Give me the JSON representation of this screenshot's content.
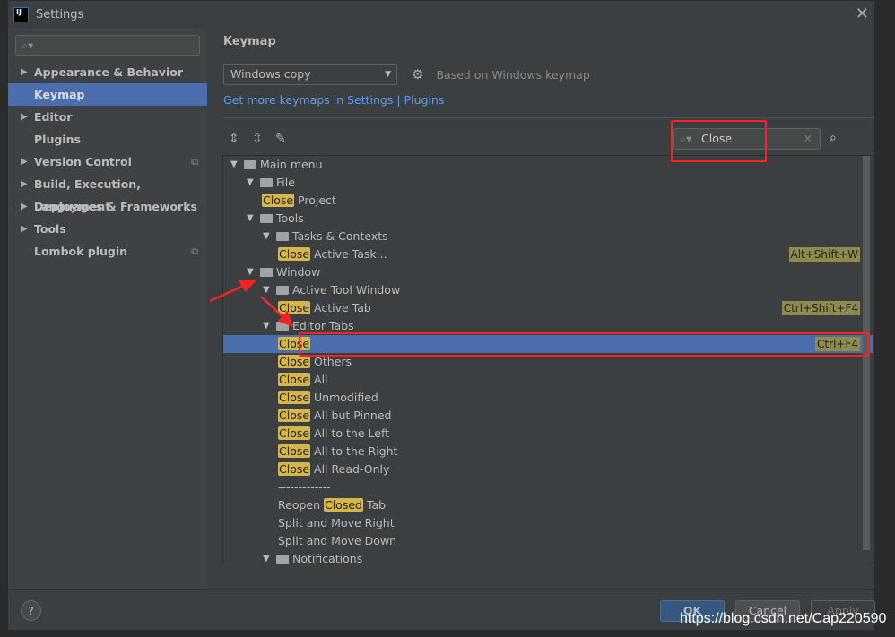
{
  "window": {
    "title": "Settings",
    "logo": "IJ"
  },
  "sidebar": {
    "search_placeholder": "",
    "items": [
      {
        "label": "Appearance & Behavior",
        "expandable": true
      },
      {
        "label": "Keymap",
        "selected": true
      },
      {
        "label": "Editor",
        "expandable": true
      },
      {
        "label": "Plugins"
      },
      {
        "label": "Version Control",
        "expandable": true,
        "project_icon": true
      },
      {
        "label": "Build, Execution, Deployment",
        "expandable": true
      },
      {
        "label": "Languages & Frameworks",
        "expandable": true
      },
      {
        "label": "Tools",
        "expandable": true
      },
      {
        "label": "Lombok plugin",
        "project_icon": true
      }
    ]
  },
  "main": {
    "title": "Keymap",
    "keymap_value": "Windows copy",
    "based_on": "Based on Windows keymap",
    "link1": "Get more keymaps in Settings",
    "link_sep": " | ",
    "link2": "Plugins",
    "search_value": "Close"
  },
  "tree": [
    {
      "level": 0,
      "type": "folder",
      "label": "Main menu",
      "expanded": true
    },
    {
      "level": 1,
      "type": "folder",
      "label": "File",
      "expanded": true
    },
    {
      "level": 2,
      "type": "action",
      "hl": "Close",
      "rest": " Project"
    },
    {
      "level": 1,
      "type": "folder",
      "label": "Tools",
      "expanded": true
    },
    {
      "level": 2,
      "type": "folder",
      "label": "Tasks & Contexts",
      "expanded": true
    },
    {
      "level": 3,
      "type": "action",
      "hl": "Close",
      "rest": " Active Task...",
      "shortcut": "Alt+Shift+W"
    },
    {
      "level": 1,
      "type": "folder",
      "label": "Window",
      "expanded": true
    },
    {
      "level": 2,
      "type": "folder",
      "label": "Active Tool Window",
      "expanded": true
    },
    {
      "level": 3,
      "type": "action",
      "hl": "Close",
      "rest": " Active Tab",
      "shortcut": "Ctrl+Shift+F4"
    },
    {
      "level": 2,
      "type": "folder",
      "label": "Editor Tabs",
      "expanded": true
    },
    {
      "level": 3,
      "type": "action",
      "hl": "Close",
      "rest": "",
      "shortcut": "Ctrl+F4",
      "selected": true
    },
    {
      "level": 3,
      "type": "action",
      "hl": "Close",
      "rest": " Others"
    },
    {
      "level": 3,
      "type": "action",
      "hl": "Close",
      "rest": " All"
    },
    {
      "level": 3,
      "type": "action",
      "hl": "Close",
      "rest": " Unmodified"
    },
    {
      "level": 3,
      "type": "action",
      "hl": "Close",
      "rest": " All but Pinned"
    },
    {
      "level": 3,
      "type": "action",
      "hl": "Close",
      "rest": " All to the Left"
    },
    {
      "level": 3,
      "type": "action",
      "hl": "Close",
      "rest": " All to the Right"
    },
    {
      "level": 3,
      "type": "action",
      "hl": "Close",
      "rest": " All Read-Only"
    },
    {
      "level": 3,
      "type": "action",
      "pre": "-------------",
      "hl": "",
      "rest": ""
    },
    {
      "level": 3,
      "type": "action",
      "pre": "Reopen ",
      "hl": "Closed",
      "rest": " Tab"
    },
    {
      "level": 3,
      "type": "action",
      "pre": "Split and Move Right",
      "hl": "",
      "rest": ""
    },
    {
      "level": 3,
      "type": "action",
      "pre": "Split and Move Down",
      "hl": "",
      "rest": ""
    },
    {
      "level": 2,
      "type": "folder",
      "label": "Notifications",
      "expanded": true
    }
  ],
  "footer": {
    "help": "?",
    "ok": "OK",
    "cancel": "Cancel",
    "apply": "Apply"
  },
  "watermark": "https://blog.csdn.net/Cap220590",
  "colors": {
    "accent": "#4b6eaf",
    "highlight": "#d6b54a",
    "annotation": "#ff2020"
  }
}
